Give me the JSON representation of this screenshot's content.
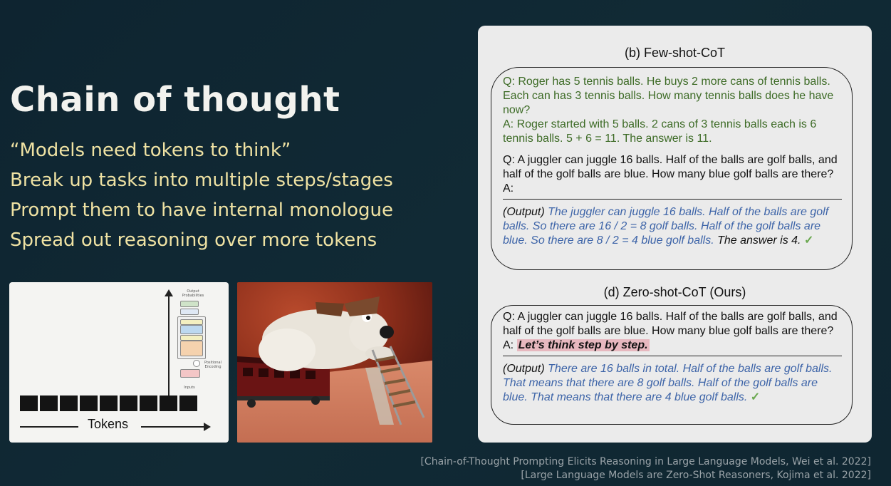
{
  "slide": {
    "title": "Chain of thought",
    "bullets": [
      "“Models need tokens to think”",
      "Break up tasks into multiple steps/stages",
      "Prompt them to have internal monologue",
      "Spread out reasoning over more tokens"
    ]
  },
  "token_figure": {
    "axis_label": "Tokens",
    "transformer_labels": {
      "output": "Output Probabilities",
      "softmax": "Softmax",
      "linear": "Linear",
      "add_norm": "Add & Norm",
      "feed_forward": "Feed Forward",
      "masked_attention": "Masked Multi-Head Attention",
      "positional": "Positional Encoding",
      "embedding": "Input Embedding",
      "inputs": "Inputs"
    }
  },
  "paper_figure": {
    "few_shot_title": "(b) Few-shot-CoT",
    "few_shot": {
      "example_q": "Q: Roger has 5 tennis balls. He buys 2 more cans of tennis balls. Each can has 3 tennis balls. How many tennis balls does he have now?",
      "example_a": "A: Roger started with 5 balls. 2 cans of 3 tennis balls each is 6 tennis balls. 5 + 6 = 11. The answer is 11.",
      "question": "Q: A juggler can juggle 16 balls. Half of the balls are golf balls, and half of the golf balls are blue. How many blue golf balls are there?",
      "answer_prefix": "A:",
      "output_tag": "(Output)",
      "output_text": "The juggler can juggle 16 balls. Half of the balls are golf balls. So there are 16 / 2 = 8 golf balls. Half of the golf balls are blue. So there are 8 / 2 = 4 blue golf balls.",
      "final_answer": "The answer is 4.",
      "check": "✓"
    },
    "zero_shot_title": "(d) Zero-shot-CoT (Ours)",
    "zero_shot": {
      "question": "Q: A juggler can juggle 16 balls. Half of the balls are golf balls, and half of the golf balls are blue. How many blue golf balls are there?",
      "answer_prefix": "A:",
      "trigger": "Let’s think step by step.",
      "output_tag": "(Output)",
      "output_text": "There are 16 balls in total. Half of the balls are golf balls. That means that there are 8 golf balls. Half of the golf balls are blue. That means that there are 4 blue golf balls.",
      "check": "✓"
    }
  },
  "citations": [
    "[Chain-of-Thought Prompting Elicits Reasoning in Large Language Models, Wei et al. 2022]",
    "[Large Language Models are Zero-Shot Reasoners, Kojima et al. 2022]"
  ]
}
